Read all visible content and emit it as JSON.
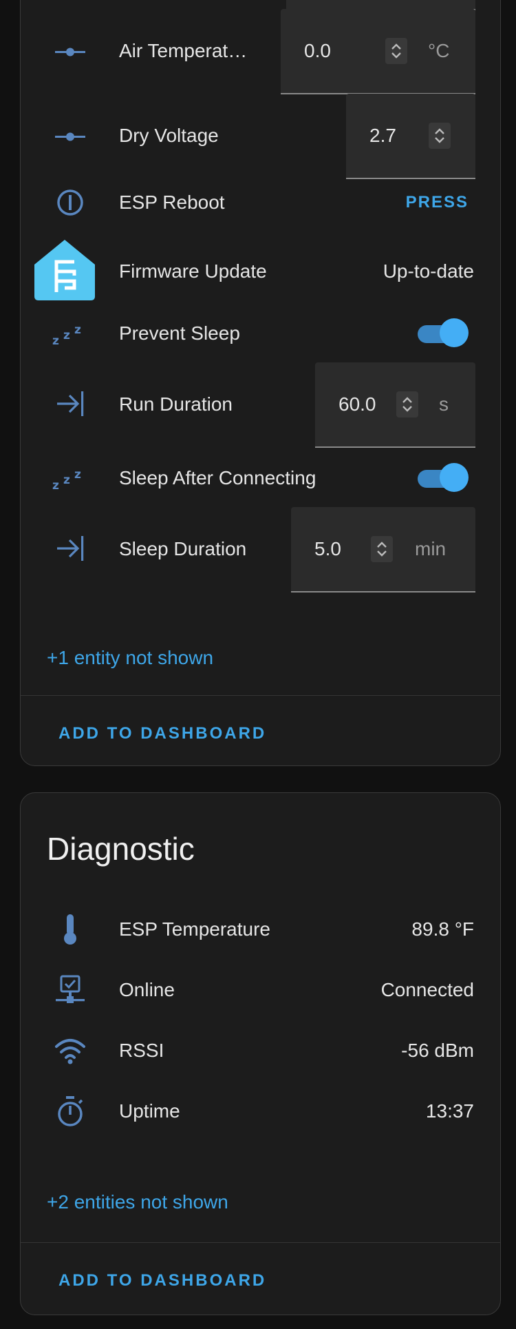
{
  "config": {
    "rows": [
      {
        "label": "Air Temperat…",
        "value": "0.0",
        "unit": "°C",
        "icon": "slider-icon"
      },
      {
        "label": "Dry Voltage",
        "value": "2.7",
        "icon": "slider-icon"
      },
      {
        "label": "ESP Reboot",
        "action": "PRESS",
        "icon": "restart-icon"
      },
      {
        "label": "Firmware Update",
        "value": "Up-to-date",
        "icon": "esphome-logo-icon"
      },
      {
        "label": "Prevent Sleep",
        "toggle": true,
        "icon": "sleep-icon"
      },
      {
        "label": "Run Duration",
        "value": "60.0",
        "unit": "s",
        "icon": "arrow-collapse-right-icon"
      },
      {
        "label": "Sleep After Connecting",
        "toggle": true,
        "icon": "sleep-icon"
      },
      {
        "label": "Sleep Duration",
        "value": "5.0",
        "unit": "min",
        "icon": "arrow-collapse-right-icon"
      }
    ],
    "more": "+1 entity not shown",
    "add_button": "ADD TO DASHBOARD"
  },
  "diagnostic": {
    "title": "Diagnostic",
    "rows": [
      {
        "label": "ESP Temperature",
        "value": "89.8 °F",
        "icon": "thermometer-icon"
      },
      {
        "label": "Online",
        "value": "Connected",
        "icon": "network-icon"
      },
      {
        "label": "RSSI",
        "value": "-56 dBm",
        "icon": "wifi-icon"
      },
      {
        "label": "Uptime",
        "value": "13:37",
        "icon": "timer-icon"
      }
    ],
    "more": "+2 entities not shown",
    "add_button": "ADD TO DASHBOARD"
  },
  "colors": {
    "accent": "#3ea6e8",
    "icon": "#5a87c0",
    "card": "#1c1c1c",
    "background": "#111111"
  }
}
